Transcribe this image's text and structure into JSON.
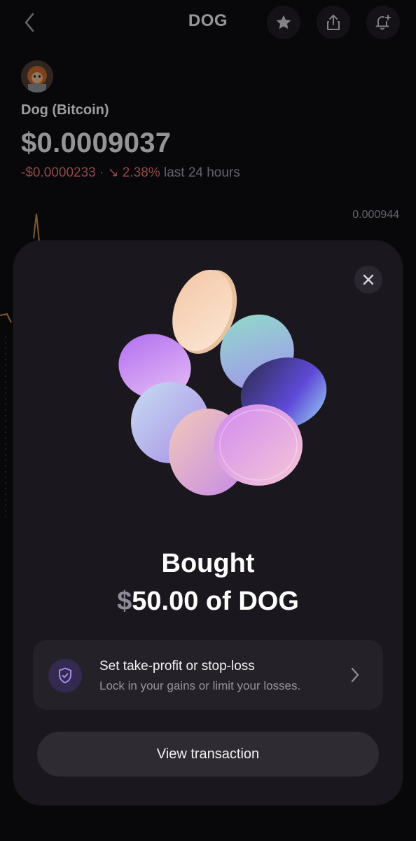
{
  "header": {
    "title": "DOG",
    "icons": [
      "chevron-left-icon",
      "star-icon",
      "share-icon",
      "bell-plus-icon"
    ]
  },
  "coin": {
    "name": "Dog (Bitcoin)",
    "price": "$0.0009037",
    "change_amount": "-$0.0000233 ·",
    "change_pct": "↘ 2.38%",
    "change_period": "last 24 hours",
    "chart_max_label": "0.000944"
  },
  "modal": {
    "headline": "Bought",
    "currency_symbol": "$",
    "amount_text": "50.00 of DOG",
    "tp_title": "Set take-profit or stop-loss",
    "tp_subtitle": "Lock in your gains or limit your losses.",
    "view_button": "View transaction"
  },
  "colors": {
    "background": "#0d0b10",
    "modal": "#1a171e",
    "negative": "#e26d6d",
    "chart_line": "#c9874a"
  }
}
